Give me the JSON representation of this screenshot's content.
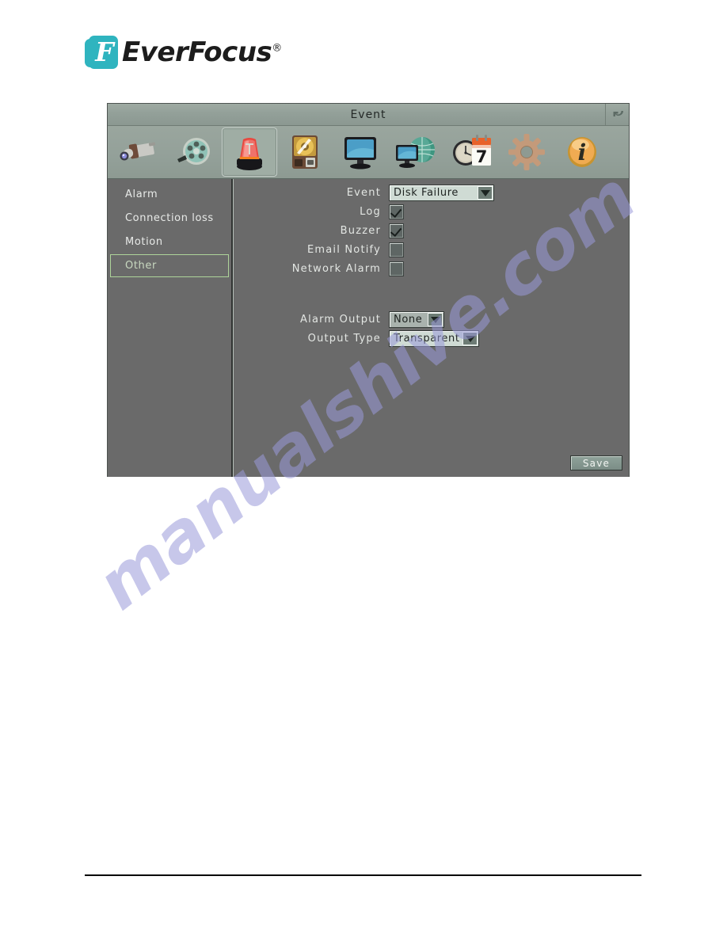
{
  "brand": {
    "name": "EverFocus",
    "mark_letter": "F",
    "registered": "®",
    "color": "#2fb4bf"
  },
  "watermark": {
    "text": "manualshive.com",
    "color": "#9a9ada"
  },
  "window": {
    "title": "Event",
    "back_icon": "back-arrow-icon"
  },
  "toolbar": {
    "items": [
      {
        "icon": "camera-icon",
        "label": "Camera"
      },
      {
        "icon": "film-reel-icon",
        "label": "Record"
      },
      {
        "icon": "alarm-siren-icon",
        "label": "Event",
        "selected": true
      },
      {
        "icon": "hard-disk-icon",
        "label": "Disk"
      },
      {
        "icon": "monitor-icon",
        "label": "Display"
      },
      {
        "icon": "network-globe-icon",
        "label": "Network"
      },
      {
        "icon": "clock-calendar-icon",
        "label": "Schedule"
      },
      {
        "icon": "gear-icon",
        "label": "System"
      },
      {
        "icon": "info-icon",
        "label": "Information"
      }
    ]
  },
  "sidebar": {
    "items": [
      {
        "label": "Alarm",
        "active": false
      },
      {
        "label": "Connection loss",
        "active": false
      },
      {
        "label": "Motion",
        "active": false
      },
      {
        "label": "Other",
        "active": true
      }
    ]
  },
  "form": {
    "event": {
      "label": "Event",
      "value": "Disk  Failure"
    },
    "log": {
      "label": "Log",
      "checked": true
    },
    "buzzer": {
      "label": "Buzzer",
      "checked": true
    },
    "email_notify": {
      "label": "Email  Notify",
      "checked": false
    },
    "network_alarm": {
      "label": "Network  Alarm",
      "checked": false
    },
    "alarm_output": {
      "label": "Alarm  Output",
      "value": "None"
    },
    "output_type": {
      "label": "Output  Type",
      "value": "Transparent"
    },
    "save": {
      "label": "Save"
    }
  }
}
